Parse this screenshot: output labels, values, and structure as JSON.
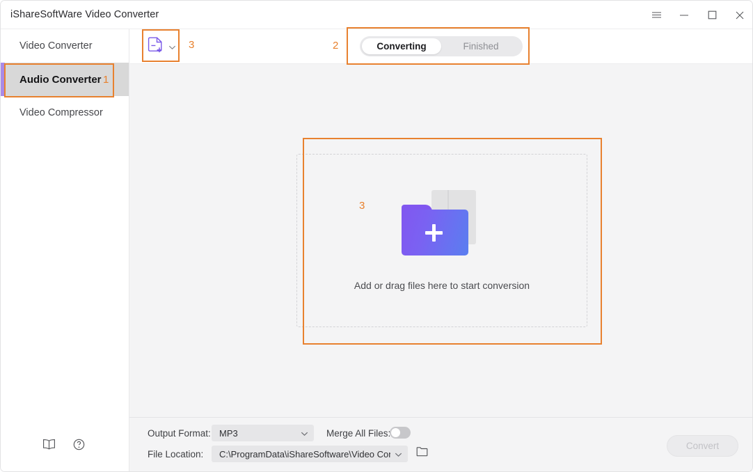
{
  "window": {
    "title": "iShareSoftWare Video Converter",
    "controls": [
      {
        "name": "menu-button",
        "icon": "hamburger-icon"
      },
      {
        "name": "minimize-button",
        "icon": "minimize-icon"
      },
      {
        "name": "maximize-button",
        "icon": "maximize-icon"
      },
      {
        "name": "close-button",
        "icon": "close-icon"
      }
    ]
  },
  "sidebar": {
    "items": [
      {
        "label": "Video Converter",
        "selected": false
      },
      {
        "label": "Audio Converter",
        "selected": true
      },
      {
        "label": "Video Compressor",
        "selected": false
      }
    ],
    "footer_icons": [
      {
        "name": "manual-icon"
      },
      {
        "name": "help-icon"
      }
    ],
    "accent_color": "#a98ae8",
    "selected_bg": "#d8d8d8"
  },
  "toolbar": {
    "add_file": {
      "name": "add-file-button",
      "icon": "add-document-icon",
      "dropdown_icon": "chevron-down-icon",
      "icon_color": "#7a5ae8"
    },
    "segmented": {
      "options": [
        {
          "label": "Converting",
          "active": true
        },
        {
          "label": "Finished",
          "active": false
        }
      ]
    }
  },
  "main": {
    "dropzone": {
      "text": "Add or drag files here to start conversion",
      "icon": "add-folder-icon",
      "folder_gradient_from": "#8157f0",
      "folder_gradient_to": "#5a7ef0"
    }
  },
  "bottom": {
    "output_format_label": "Output Format:",
    "output_format_value": "MP3",
    "merge_label": "Merge All Files:",
    "merge_enabled": false,
    "file_location_label": "File Location:",
    "file_location_value": "C:\\ProgramData\\iShareSoftware\\Video Conve",
    "browse_icon": "folder-icon",
    "convert_label": "Convert",
    "convert_enabled": false
  },
  "annotations": {
    "color": "#e8812f",
    "markers": [
      {
        "id": "sidebar-audio-converter",
        "number": "1"
      },
      {
        "id": "converting-finished-tabs",
        "number": "2"
      },
      {
        "id": "add-file-toolbar",
        "number": "3"
      },
      {
        "id": "dropzone-area",
        "number": "3"
      }
    ]
  }
}
